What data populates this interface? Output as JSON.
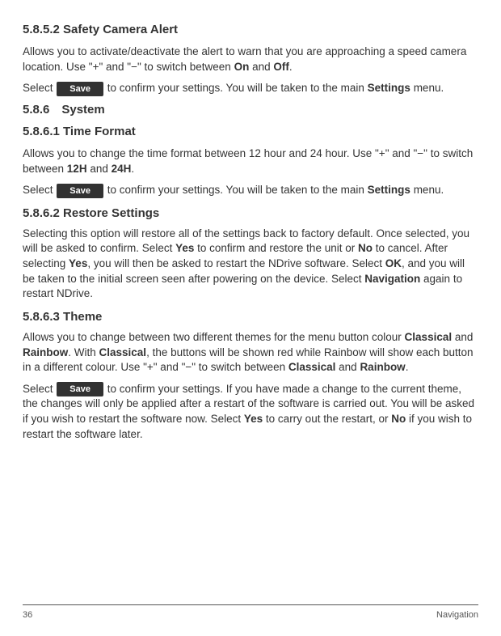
{
  "headings": {
    "h_58_5_2": "5.8.5.2 Safety Camera Alert",
    "h_58_6": "5.8.6 System",
    "h_58_6_1": "5.8.6.1 Time Format",
    "h_58_6_2": "5.8.6.2 Restore Settings",
    "h_58_6_3": "5.8.6.3 Theme"
  },
  "save_label": "Save",
  "p1a": "Allows you to activate/deactivate the alert to warn that you are approaching a speed camera location. Use \"+\" and \"−\" to switch between ",
  "p1_on": "On",
  "p1_and": " and ",
  "p1_off": "Off",
  "p1_end": ".",
  "p2_select": "Select ",
  "p2_conf": " to confirm your settings. You will be taken to the main ",
  "p2_settings": "Settings",
  "p2_menu": " menu.",
  "p3a": "Allows you to change the time format between 12 hour and 24 hour. Use \"+\" and \"−\" to switch between ",
  "p3_12h": "12H",
  "p3_and": " and ",
  "p3_24h": "24H",
  "p3_end": ".",
  "p4_select": "Select ",
  "p4_conf": " to confirm your settings. You will be taken to the main ",
  "p4_settings": "Settings",
  "p4_menu": " menu.",
  "p5a": "Selecting this option will restore all of the settings back to factory default. Once selected, you will be asked to confirm. Select ",
  "p5_yes": "Yes",
  "p5b": " to confirm and restore the unit or ",
  "p5_no": "No",
  "p5c": " to cancel. After selecting ",
  "p5_yes2": "Yes",
  "p5d": ", you will then be asked to restart the NDrive software. Select ",
  "p5_ok": "OK",
  "p5e": ", and you will be taken to the initial screen seen after powering on the device. Select ",
  "p5_nav": "Navigation",
  "p5f": " again to restart NDrive.",
  "p6a": "Allows you to change between two different themes for the menu button colour ",
  "p6_classical": "Classical",
  "p6_and1": " and ",
  "p6_rainbow": "Rainbow",
  "p6b": ". With ",
  "p6_classical2": "Classical",
  "p6c": ", the buttons will be shown red while Rainbow will show each button in a different colour. Use \"+\" and \"−\"  to switch between ",
  "p6_classical3": "Classical",
  "p6_and2": " and ",
  "p6_rainbow2": "Rainbow",
  "p6_end": ".",
  "p7_select": "Select ",
  "p7_conf": "  to confirm your settings. If you have made a change to the current theme, the changes will only be applied after a restart of the software is carried out. You will be asked if you wish to restart the software now. Select ",
  "p7_yes": "Yes",
  "p7b": " to carry out the restart, or ",
  "p7_no": "No",
  "p7c": " if you wish to restart the software later.",
  "footer": {
    "page": "36",
    "section": "Navigation"
  }
}
